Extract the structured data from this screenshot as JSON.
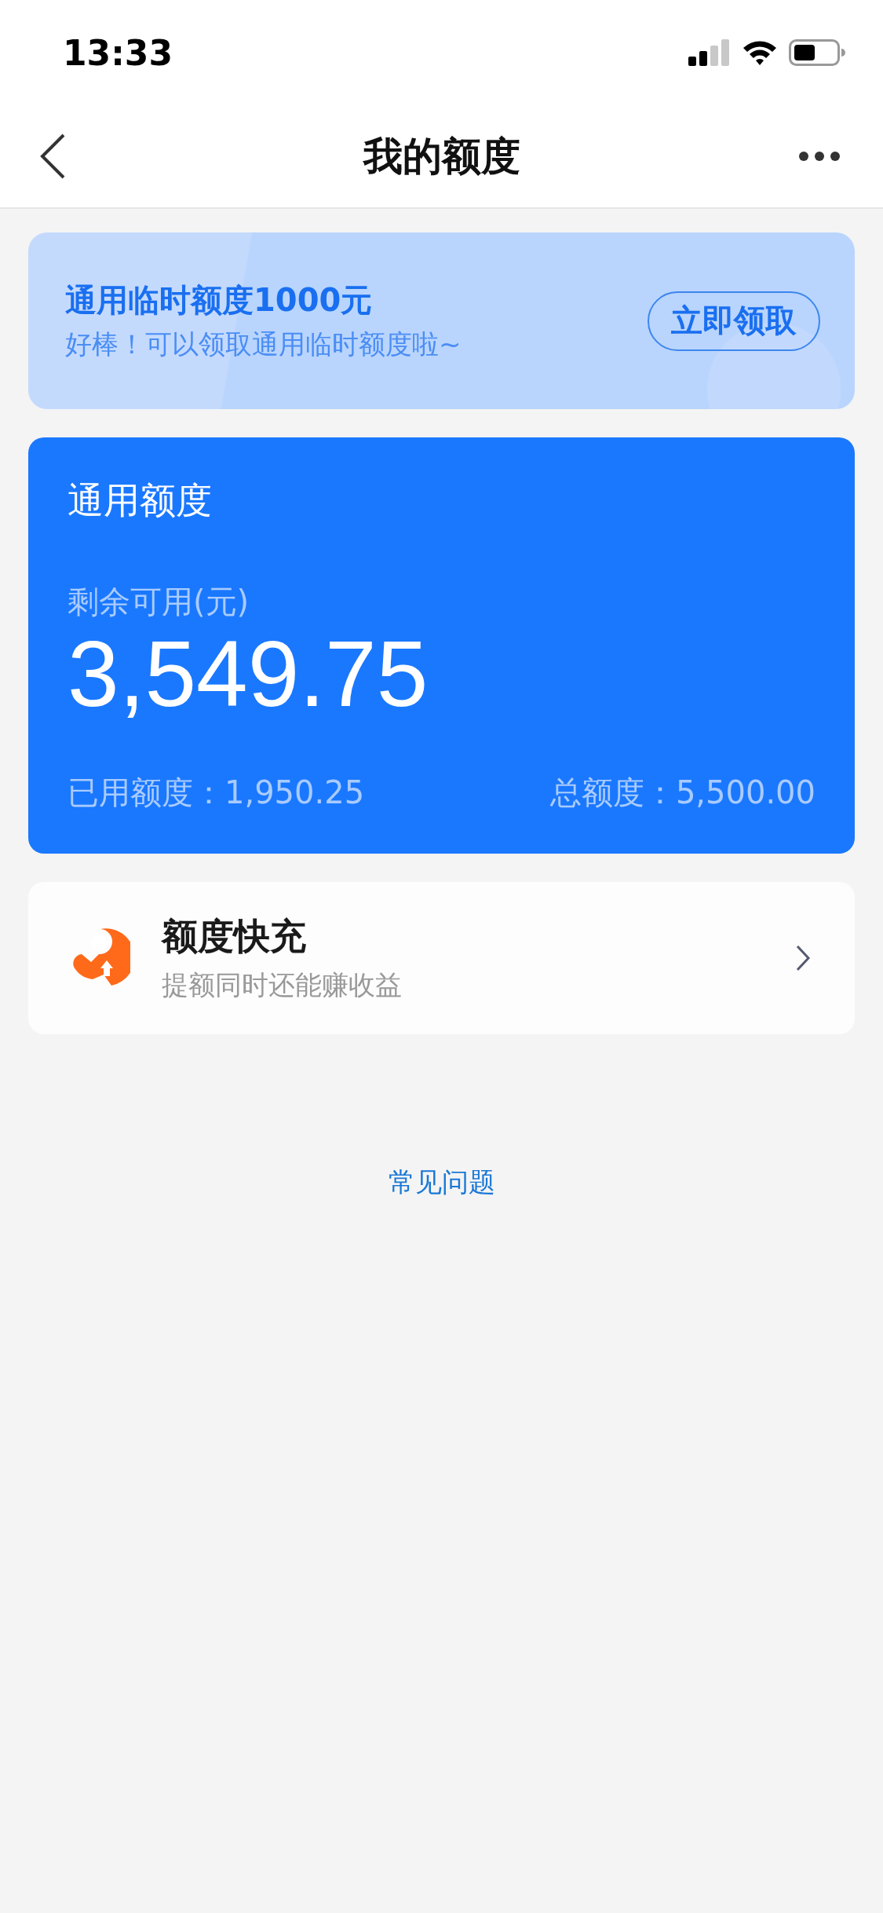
{
  "status_bar": {
    "time": "13:33"
  },
  "nav": {
    "title": "我的额度"
  },
  "promo": {
    "title": "通用临时额度1000元",
    "subtitle": "好棒！可以领取通用临时额度啦~",
    "button": "立即领取"
  },
  "quota_card": {
    "title": "通用额度",
    "available_label": "剩余可用(元)",
    "available": "3,549.75",
    "used": "已用额度：1,950.25",
    "total": "总额度：5,500.00"
  },
  "quick_charge": {
    "title": "额度快充",
    "subtitle": "提额同时还能赚收益"
  },
  "faq_link": "常见问题"
}
